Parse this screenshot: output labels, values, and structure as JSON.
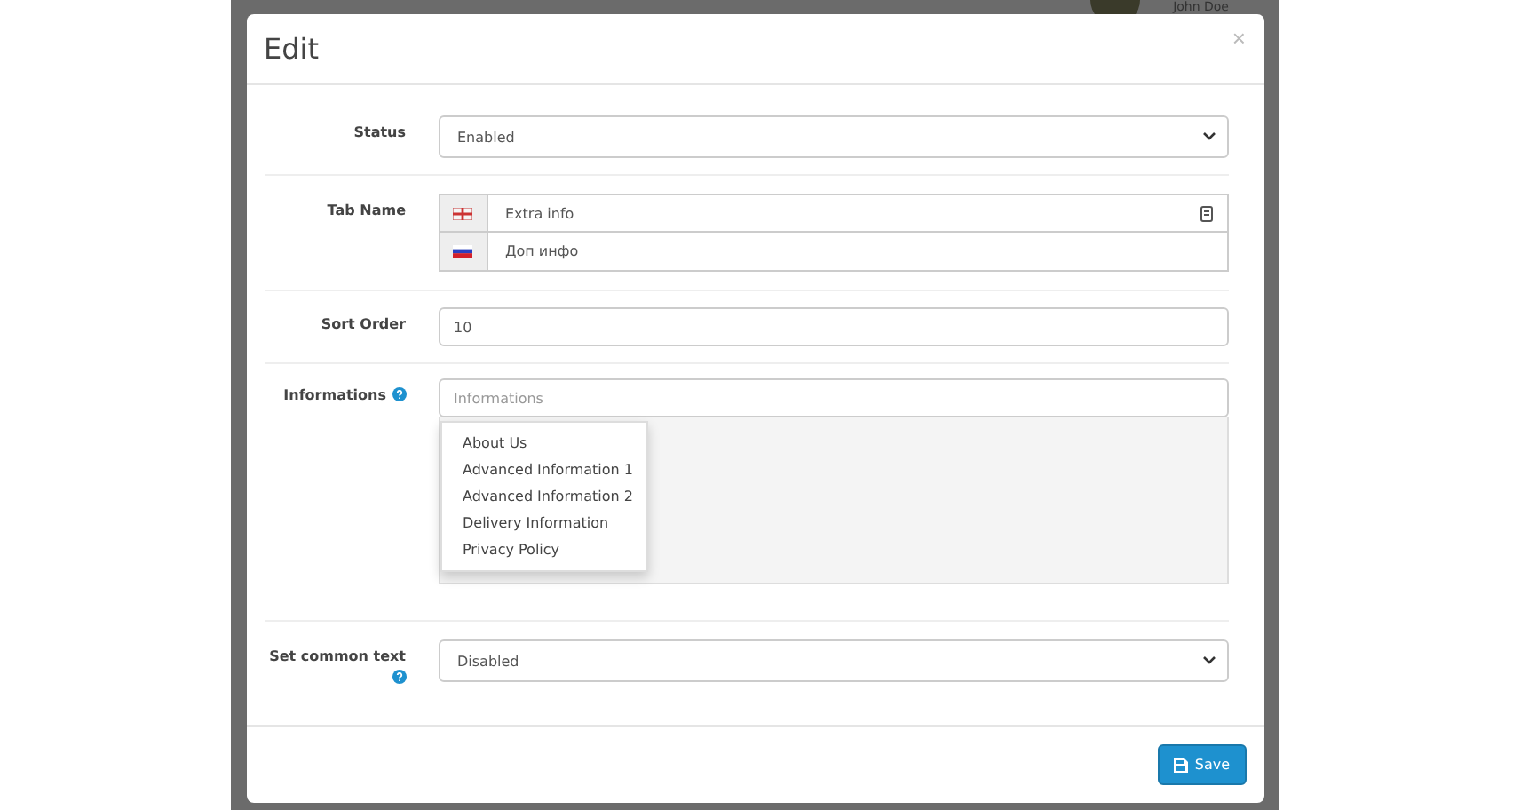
{
  "backdrop": {
    "user_name": "John Doe"
  },
  "modal": {
    "title": "Edit",
    "close": "×"
  },
  "form": {
    "status": {
      "label": "Status",
      "value": "Enabled"
    },
    "tab_name": {
      "label": "Tab Name",
      "entries": [
        {
          "kind": "english",
          "value": "Extra info"
        },
        {
          "kind": "russian",
          "value": "Доп инфо"
        }
      ]
    },
    "sort_order": {
      "label": "Sort Order",
      "value": "10"
    },
    "informations": {
      "label": "Informations",
      "placeholder": "Informations",
      "suggestions": [
        "About Us",
        "Advanced Information 1",
        "Advanced Information 2",
        "Delivery Information",
        "Privacy Policy"
      ]
    },
    "common_text": {
      "label": "Set common text",
      "value": "Disabled"
    }
  },
  "footer": {
    "save": "Save"
  }
}
